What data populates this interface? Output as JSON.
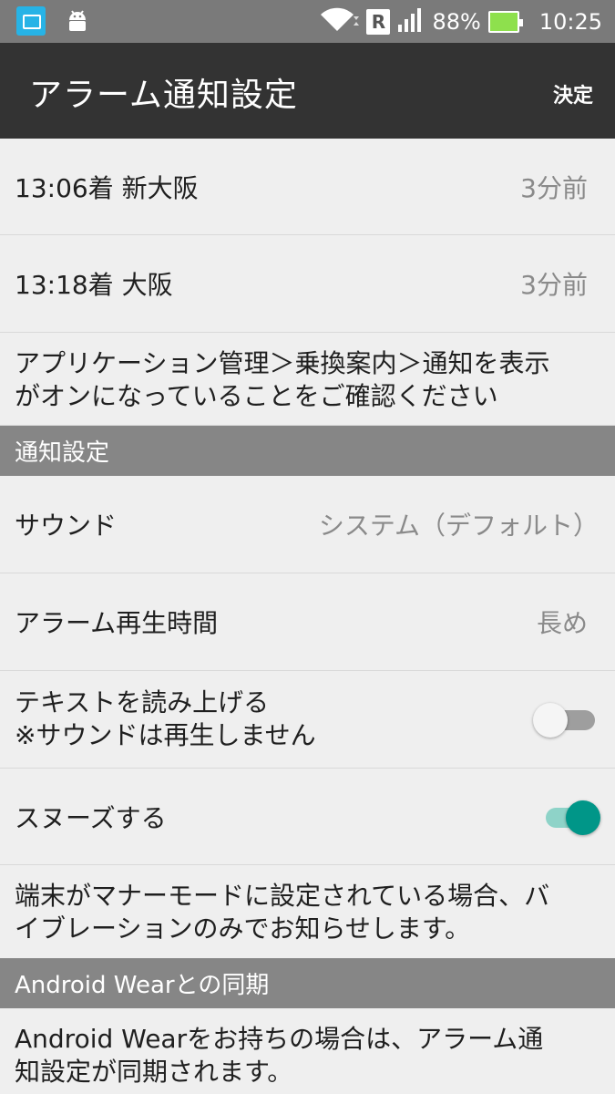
{
  "statusbar": {
    "battery": "88%",
    "time": "10:25",
    "roaming": "R"
  },
  "actionbar": {
    "title": "アラーム通知設定",
    "action": "決定"
  },
  "alarms": [
    {
      "label": "13:06着 新大阪",
      "value": "3分前"
    },
    {
      "label": "13:18着 大阪",
      "value": "3分前"
    }
  ],
  "notice": {
    "line1": "アプリケーション管理＞乗換案内＞通知を表示",
    "line2": "がオンになっていることをご確認ください"
  },
  "notification_settings": {
    "header": "通知設定",
    "sound": {
      "label": "サウンド",
      "value": "システム（デフォルト）"
    },
    "duration": {
      "label": "アラーム再生時間",
      "value": "長め"
    },
    "tts": {
      "line1": "テキストを読み上げる",
      "line2": "※サウンドは再生しません",
      "enabled": false
    },
    "snooze": {
      "label": "スヌーズする",
      "enabled": true
    },
    "vibrate_note": {
      "line1": "端末がマナーモードに設定されている場合、バ",
      "line2": "イブレーションのみでお知らせします。"
    }
  },
  "wear": {
    "header": "Android Wearとの同期",
    "line1": "Android Wearをお持ちの場合は、アラーム通",
    "line2": "知設定が同期されます。"
  },
  "colors": {
    "accent": "#009688",
    "actionbar": "#333333",
    "section": "#868686"
  }
}
